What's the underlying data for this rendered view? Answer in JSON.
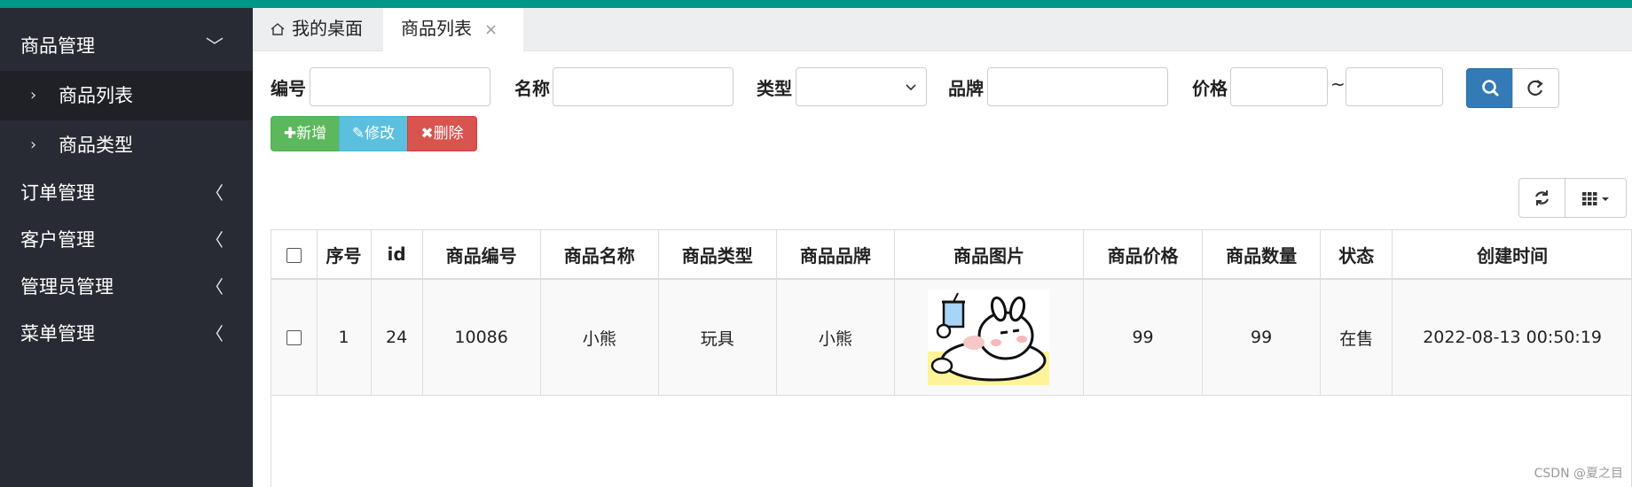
{
  "sidebar": {
    "groups": [
      {
        "label": "商品管理",
        "arrow": "﹀"
      },
      {
        "label": "订单管理",
        "arrow": "〈"
      },
      {
        "label": "客户管理",
        "arrow": "〈"
      },
      {
        "label": "管理员管理",
        "arrow": "〈"
      },
      {
        "label": "菜单管理",
        "arrow": "〈"
      }
    ],
    "sub_items": [
      {
        "label": "商品列表",
        "chev": "›"
      },
      {
        "label": "商品类型",
        "chev": "›"
      }
    ]
  },
  "tabs": [
    {
      "label": "我的桌面"
    },
    {
      "label": "商品列表",
      "close": "×"
    }
  ],
  "search": {
    "code_label": "编号",
    "name_label": "名称",
    "type_label": "类型",
    "brand_label": "品牌",
    "price_label": "价格",
    "tilde": "~",
    "code_value": "",
    "name_value": "",
    "type_value": "",
    "brand_value": "",
    "price_min": "",
    "price_max": ""
  },
  "toolbar": {
    "add_label": "✚新增",
    "edit_label": "✎修改",
    "delete_label": "✖删除"
  },
  "table": {
    "columns": [
      "序号",
      "id",
      "商品编号",
      "商品名称",
      "商品类型",
      "商品品牌",
      "商品图片",
      "商品价格",
      "商品数量",
      "状态",
      "创建时间"
    ],
    "rows": [
      {
        "index": "1",
        "id": "24",
        "code": "10086",
        "name": "小熊",
        "type": "玩具",
        "brand": "小熊",
        "image": "bear-sticker",
        "price": "99",
        "quantity": "99",
        "status": "在售",
        "created": "2022-08-13 00:50:19"
      }
    ]
  },
  "icons": {
    "home": "home-icon",
    "search": "search-icon",
    "refresh": "refresh-icon",
    "columns": "grid-icon"
  },
  "colors": {
    "topbar": "#009688",
    "sidebar": "#282b33",
    "primary": "#337ab7",
    "success": "#5cb85c",
    "info": "#5bc0de",
    "danger": "#d9534f"
  },
  "watermark": "CSDN @夏之目"
}
